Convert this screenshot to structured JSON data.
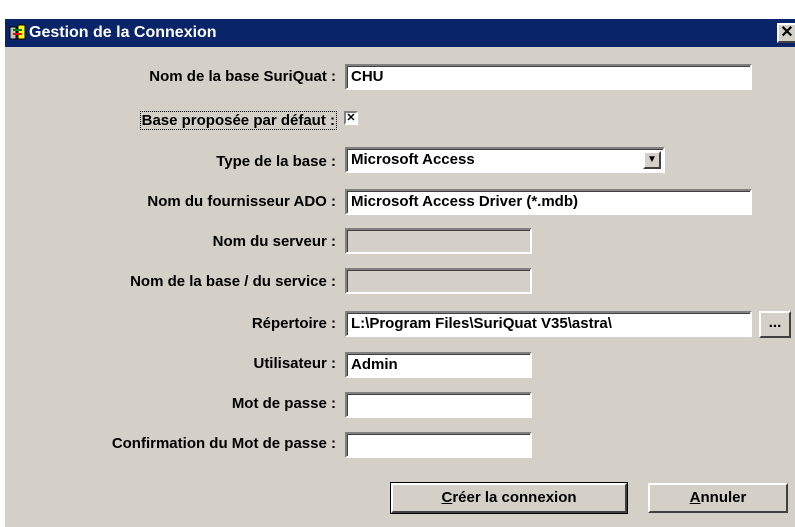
{
  "window": {
    "title": "Gestion de la Connexion",
    "close_glyph": "✕"
  },
  "form": {
    "nom_base_label": "Nom de la base SuriQuat :",
    "nom_base_value": "CHU",
    "base_defaut_label": "Base proposée par défaut :",
    "base_defaut_checked": true,
    "base_defaut_mark": "✕",
    "type_base_label": "Type de la base :",
    "type_base_value": "Microsoft Access",
    "fournisseur_label": "Nom du fournisseur ADO :",
    "fournisseur_value": "Microsoft Access Driver (*.mdb)",
    "serveur_label": "Nom du serveur :",
    "serveur_value": "",
    "base_service_label": "Nom de la base / du service :",
    "base_service_value": "",
    "repertoire_label": "Répertoire :",
    "repertoire_value": "L:\\Program Files\\SuriQuat V35\\astra\\",
    "browse_label": "...",
    "utilisateur_label": "Utilisateur :",
    "utilisateur_value": "Admin",
    "mot_de_passe_label": "Mot de passe :",
    "mot_de_passe_value": "",
    "confirmation_label": "Confirmation du Mot de passe :",
    "confirmation_value": ""
  },
  "buttons": {
    "creer_mnemonic": "C",
    "creer_rest": "réer la connexion",
    "annuler_mnemonic": "A",
    "annuler_rest": "nnuler"
  },
  "icons": {
    "app_icon": "connection-icon",
    "select_arrow": "▼"
  }
}
